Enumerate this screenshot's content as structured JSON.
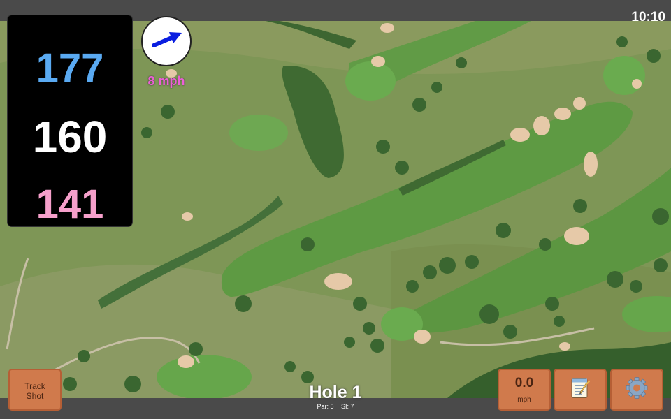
{
  "status_bar": {
    "time": "10:10"
  },
  "distances": {
    "back": "177",
    "middle": "160",
    "front": "141"
  },
  "wind": {
    "speed_label": "8 mph",
    "direction_icon": "arrow-right-icon"
  },
  "hole": {
    "title": "Hole 1",
    "par_label": "Par: 5",
    "si_label": "SI: 7"
  },
  "buttons": {
    "track_shot": {
      "line1": "Track",
      "line2": "Shot"
    },
    "speed": {
      "value": "0.0",
      "unit": "mph"
    },
    "notes_icon": "notepad-icon",
    "settings_icon": "gear-icon"
  },
  "colors": {
    "back_distance": "#5aaaf2",
    "middle_distance": "#ffffff",
    "front_distance": "#f6a0cb",
    "wind_label": "#ec5fd6",
    "button_fill": "#d07a4c"
  }
}
